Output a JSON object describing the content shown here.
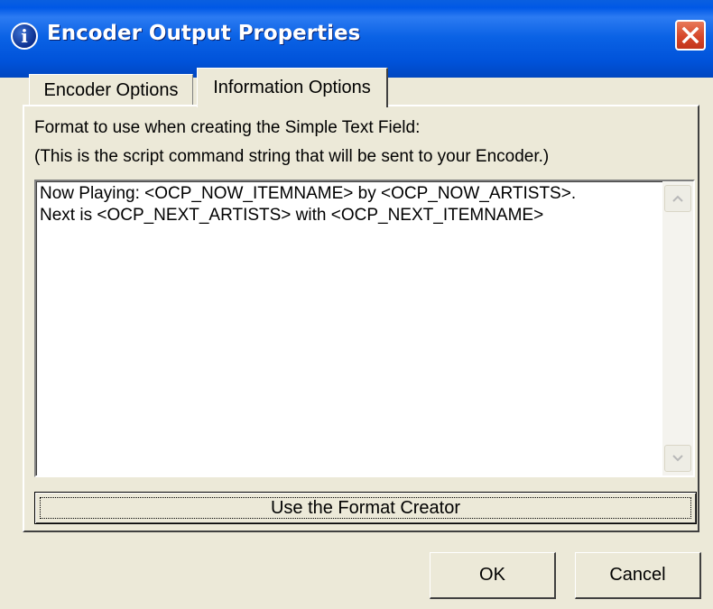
{
  "window": {
    "title": "Encoder Output Properties",
    "title_icon": "info-icon",
    "close_icon": "close-icon"
  },
  "tabs": [
    {
      "label": "Encoder Options",
      "active": false
    },
    {
      "label": "Information Options",
      "active": true
    }
  ],
  "content": {
    "description_line1": "Format to use when creating the Simple Text Field:",
    "description_line2": "(This is the script command string that will be sent to your Encoder.)",
    "format_text_lines": [
      "Now Playing: <OCP_NOW_ITEMNAME> by <OCP_NOW_ARTISTS>.",
      "Next is <OCP_NEXT_ARTISTS> with <OCP_NEXT_ITEMNAME>"
    ],
    "format_creator_label": "Use the Format Creator"
  },
  "footer": {
    "ok_label": "OK",
    "cancel_label": "Cancel"
  },
  "colors": {
    "title_bar": "#0054e3",
    "dialog_bg": "#ece9d8",
    "close_button": "#d6472a"
  }
}
